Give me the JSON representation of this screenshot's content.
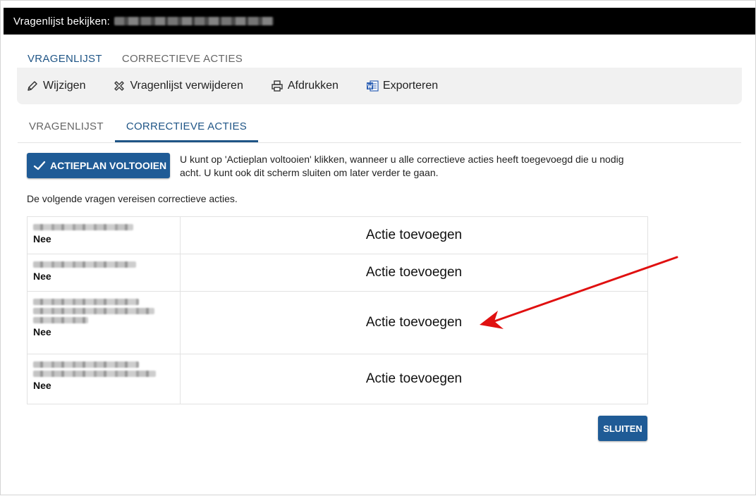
{
  "window": {
    "title": "Vragenlijst bekijken:"
  },
  "tabs_top": [
    "VRAGENLIJST",
    "CORRECTIEVE ACTIES"
  ],
  "toolbar": {
    "edit": "Wijzigen",
    "delete": "Vragenlijst verwijderen",
    "print": "Afdrukken",
    "export": "Exporteren"
  },
  "tabs_second": [
    "VRAGENLIJST",
    "CORRECTIEVE ACTIES"
  ],
  "actionplan": {
    "button": "ACTIEPLAN VOLTOOIEN",
    "info": "U kunt op 'Actieplan voltooien' klikken, wanneer u alle correctieve acties heeft toegevoegd die u nodig acht. U kunt ook dit scherm sluiten om later verder te gaan."
  },
  "lead": "De volgende vragen vereisen correctieve acties.",
  "rows": [
    {
      "answer": "Nee",
      "action": "Actie toevoegen"
    },
    {
      "answer": "Nee",
      "action": "Actie toevoegen"
    },
    {
      "answer": "Nee",
      "action": "Actie toevoegen"
    },
    {
      "answer": "Nee",
      "action": "Actie toevoegen"
    }
  ],
  "close_button": "SLUITEN",
  "colors": {
    "primary": "#1f5b96",
    "tab_active": "#1f5586",
    "annotation_arrow": "#e01010",
    "titlebar": "#000000"
  },
  "icons": {
    "edit": "pencil-icon",
    "delete": "cross-icon",
    "print": "printer-icon",
    "export": "word-icon",
    "complete": "checkmark-icon"
  }
}
